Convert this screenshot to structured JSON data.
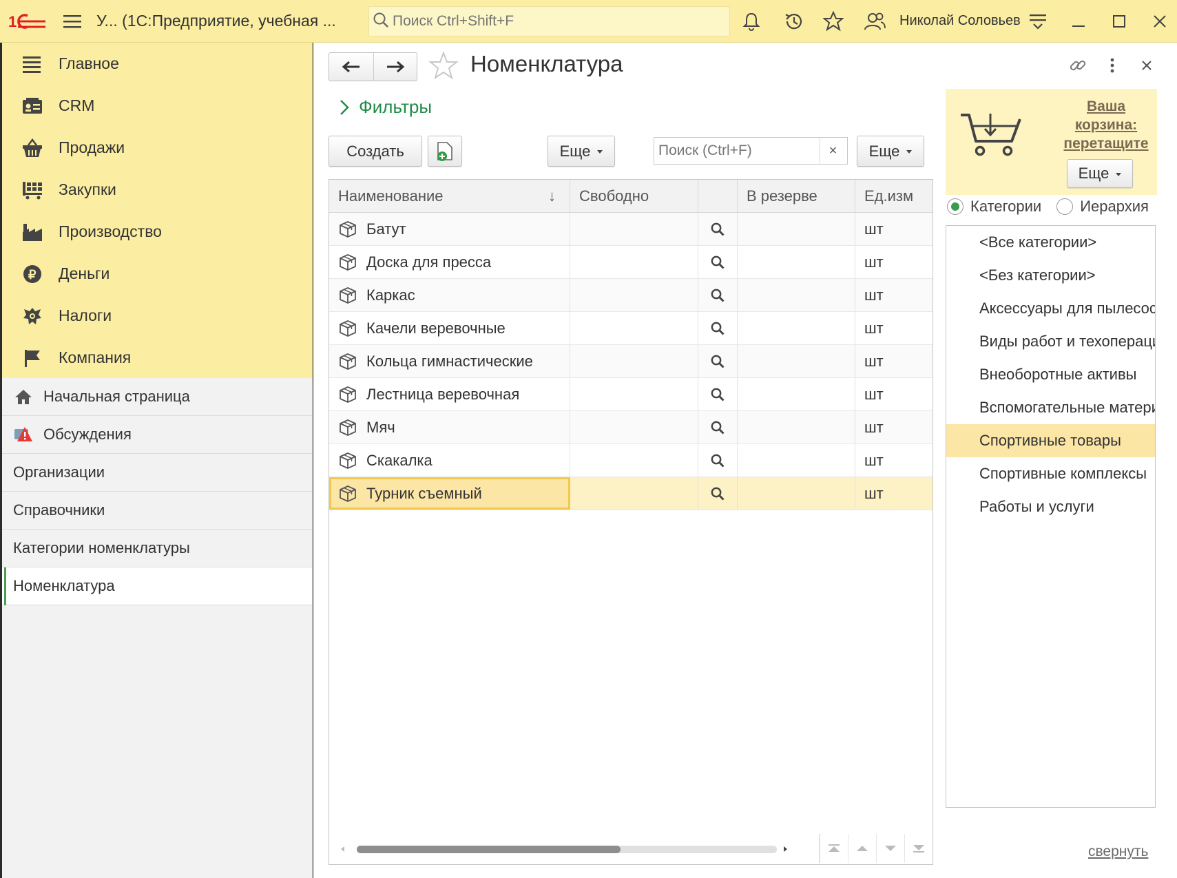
{
  "app": {
    "title": "У... (1С:Предприятие, учебная ...",
    "search_placeholder": "Поиск Ctrl+Shift+F",
    "user_name": "Николай Соловьев"
  },
  "sections": [
    {
      "label": "Главное",
      "icon": "menu-lines-icon"
    },
    {
      "label": "CRM",
      "icon": "crm-card-icon"
    },
    {
      "label": "Продажи",
      "icon": "basket-icon"
    },
    {
      "label": "Закупки",
      "icon": "cart-grid-icon"
    },
    {
      "label": "Производство",
      "icon": "factory-icon"
    },
    {
      "label": "Деньги",
      "icon": "ruble-coin-icon"
    },
    {
      "label": "Налоги",
      "icon": "emblem-icon"
    },
    {
      "label": "Компания",
      "icon": "flag-icon"
    }
  ],
  "nav": [
    {
      "label": "Начальная страница",
      "icon": "home-icon"
    },
    {
      "label": "Обсуждения",
      "icon": "discussion-alert-icon"
    },
    {
      "label": "Организации"
    },
    {
      "label": "Справочники"
    },
    {
      "label": "Категории номенклатуры"
    },
    {
      "label": "Номенклатура",
      "active": true
    }
  ],
  "form": {
    "title": "Номенклатура",
    "filters_label": "Фильтры",
    "create_label": "Создать",
    "more_label": "Еще",
    "search_placeholder": "Поиск (Ctrl+F)",
    "clear_symbol": "×"
  },
  "table": {
    "columns": [
      "Наименование",
      "Свободно",
      "",
      "В резерве",
      "Ед.изм"
    ],
    "sort_indicator": "↓",
    "rows": [
      {
        "name": "Батут",
        "free": "",
        "reserve": "",
        "unit": "шт"
      },
      {
        "name": "Доска для пресса",
        "free": "",
        "reserve": "",
        "unit": "шт"
      },
      {
        "name": "Каркас",
        "free": "",
        "reserve": "",
        "unit": "шт"
      },
      {
        "name": "Качели веревочные",
        "free": "",
        "reserve": "",
        "unit": "шт"
      },
      {
        "name": "Кольца гимнастические",
        "free": "",
        "reserve": "",
        "unit": "шт"
      },
      {
        "name": "Лестница веревочная",
        "free": "",
        "reserve": "",
        "unit": "шт"
      },
      {
        "name": "Мяч",
        "free": "",
        "reserve": "",
        "unit": "шт"
      },
      {
        "name": "Скакалка",
        "free": "",
        "reserve": "",
        "unit": "шт"
      },
      {
        "name": "Турник съемный",
        "free": "",
        "reserve": "",
        "unit": "шт",
        "selected": true
      }
    ]
  },
  "cart": {
    "line1": "Ваша",
    "line2": "корзина:",
    "line3": "перетащите",
    "more_label": "Еще"
  },
  "view_mode": {
    "options": [
      "Категории",
      "Иерархия"
    ],
    "selected": "Категории"
  },
  "categories": [
    {
      "label": "<Все категории>"
    },
    {
      "label": "<Без категории>"
    },
    {
      "label": "Аксессуары для пылесосов"
    },
    {
      "label": "Виды работ и техоперации"
    },
    {
      "label": "Внеоборотные активы"
    },
    {
      "label": "Вспомогательные материалы"
    },
    {
      "label": "Спортивные товары",
      "selected": true
    },
    {
      "label": "Спортивные комплексы"
    },
    {
      "label": "Работы и услуги"
    }
  ],
  "collapse_label": "свернуть",
  "colors": {
    "accent_yellow": "#fbeda1",
    "selection": "#fbe6a6",
    "link_green": "#1e8c46",
    "logo_red": "#e41e26"
  }
}
